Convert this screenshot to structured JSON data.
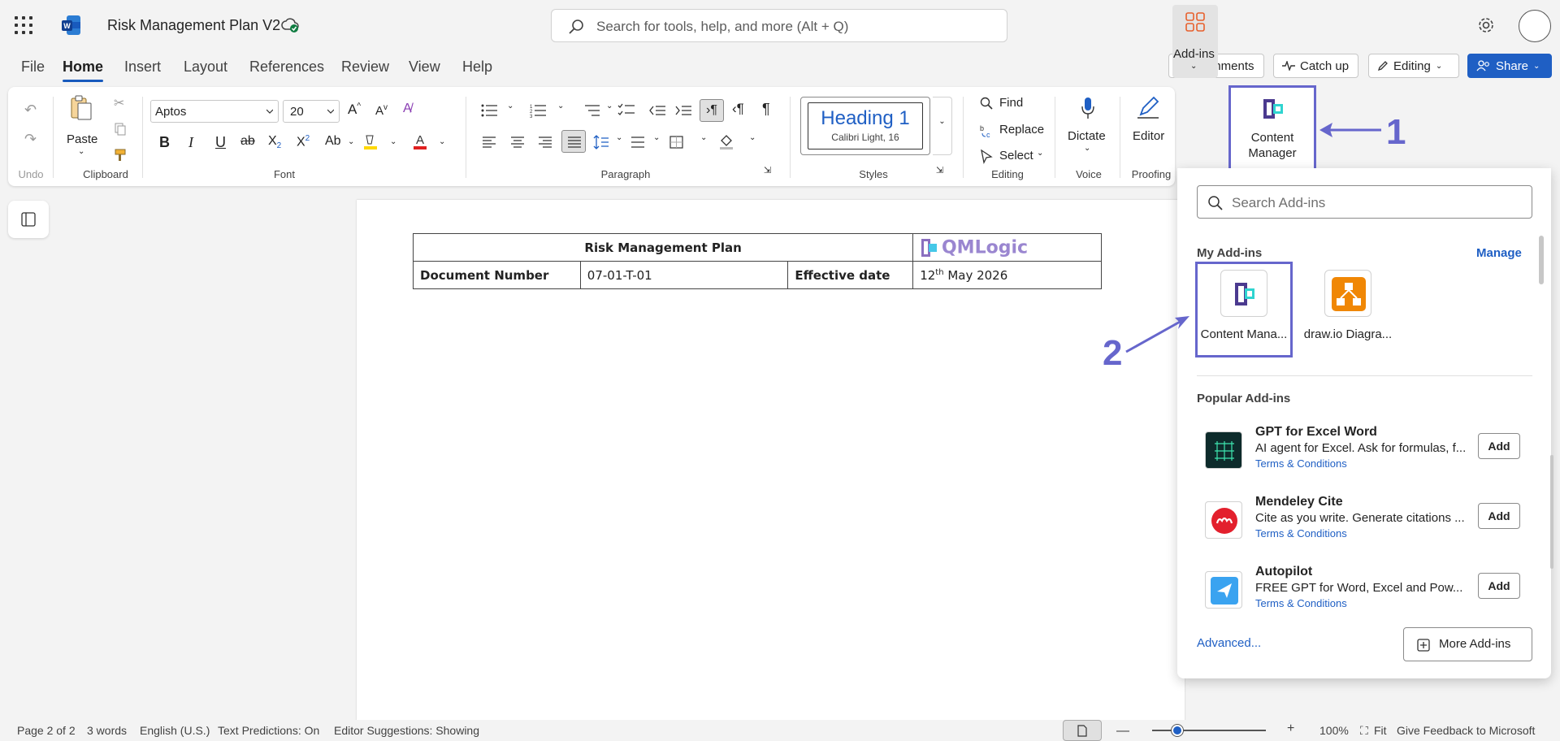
{
  "titlebar": {
    "doc_title": "Risk Management Plan V2",
    "search_placeholder": "Search for tools, help, and more (Alt + Q)"
  },
  "tabs": [
    "File",
    "Home",
    "Insert",
    "Layout",
    "References",
    "Review",
    "View",
    "Help"
  ],
  "top_buttons": {
    "comments": "Comments",
    "catchup": "Catch up",
    "editing": "Editing",
    "share": "Share"
  },
  "ribbon": {
    "undo_label": "Undo",
    "paste_label": "Paste",
    "clipboard_label": "Clipboard",
    "font_name": "Aptos",
    "font_size": "20",
    "font_label": "Font",
    "paragraph_label": "Paragraph",
    "style_heading": "Heading 1",
    "style_sub": "Calibri Light, 16",
    "styles_label": "Styles",
    "find": "Find",
    "replace": "Replace",
    "select": "Select",
    "editing_label": "Editing",
    "dictate": "Dictate",
    "voice_label": "Voice",
    "editor": "Editor",
    "proofing_label": "Proofing",
    "addins": "Add-ins",
    "content_manager_l1": "Content",
    "content_manager_l2": "Manager"
  },
  "callouts": {
    "one": "1",
    "two": "2"
  },
  "document": {
    "title": "Risk Management Plan",
    "logo_text": "QMLogic",
    "doc_number_label": "Document Number",
    "doc_number": "07-01-T-01",
    "effective_label": "Effective date",
    "effective_day": "12",
    "effective_sup": "th",
    "effective_rest": " May 2026"
  },
  "panel": {
    "search_placeholder": "Search Add-ins",
    "my_addins": "My Add-ins",
    "manage": "Manage",
    "tiles": [
      {
        "label": "Content Mana..."
      },
      {
        "label": "draw.io Diagra..."
      }
    ],
    "popular": "Popular Add-ins",
    "items": [
      {
        "name": "GPT for Excel Word",
        "desc": "AI agent for Excel. Ask for formulas, f...",
        "terms": "Terms & Conditions",
        "add": "Add"
      },
      {
        "name": "Mendeley Cite",
        "desc": "Cite as you write. Generate citations ...",
        "terms": "Terms & Conditions",
        "add": "Add"
      },
      {
        "name": "Autopilot",
        "desc": "FREE GPT for Word, Excel and Pow...",
        "terms": "Terms & Conditions",
        "add": "Add"
      }
    ],
    "advanced": "Advanced...",
    "more": "More Add-ins"
  },
  "status": {
    "page": "Page 2 of 2",
    "words": "3 words",
    "lang": "English (U.S.)",
    "predictions": "Text Predictions: On",
    "suggestions": "Editor Suggestions: Showing",
    "zoom": "100%",
    "fit": "Fit",
    "feedback": "Give Feedback to Microsoft"
  },
  "colors": {
    "accent": "#1f5fc4",
    "callout": "#6666cc"
  }
}
